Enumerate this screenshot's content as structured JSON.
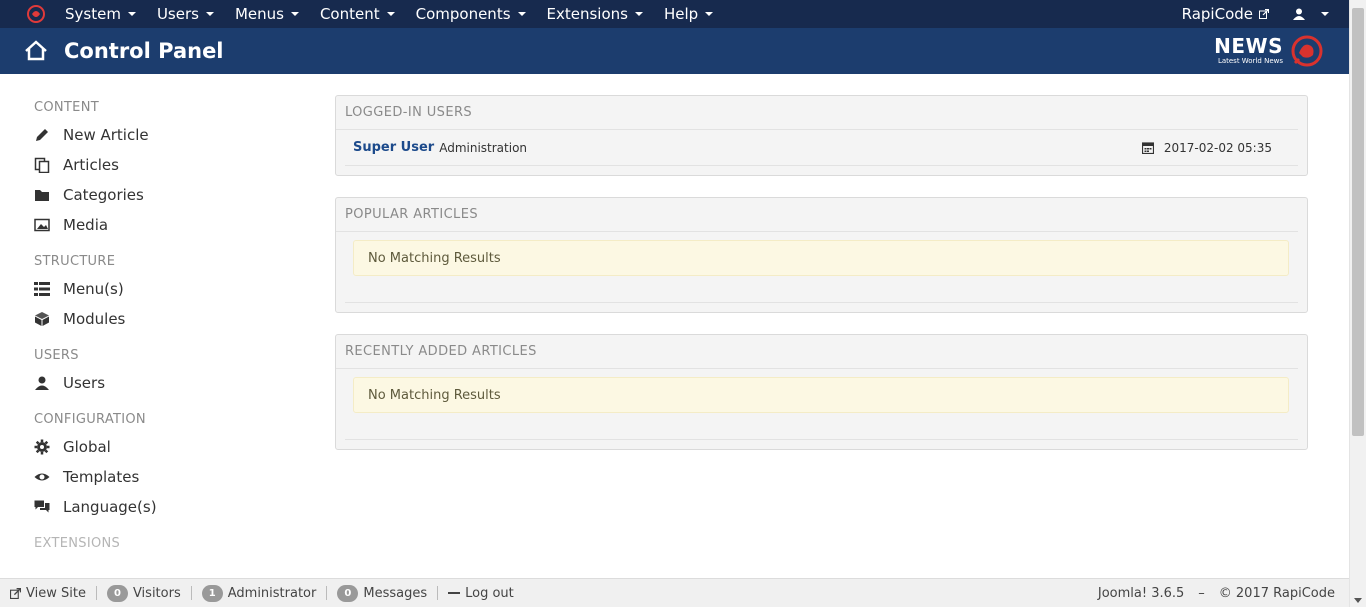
{
  "navbar": {
    "menus": [
      "System",
      "Users",
      "Menus",
      "Content",
      "Components",
      "Extensions",
      "Help"
    ],
    "site_link": "RapiCode",
    "user_menu_icon": "user-icon"
  },
  "header": {
    "title": "Control Panel",
    "brand": {
      "name": "NEWS",
      "tagline": "Latest World News"
    }
  },
  "sidebar": {
    "sections": [
      {
        "title": "CONTENT",
        "items": [
          {
            "label": "New Article",
            "icon": "pencil-icon"
          },
          {
            "label": "Articles",
            "icon": "copy-icon"
          },
          {
            "label": "Categories",
            "icon": "folder-icon"
          },
          {
            "label": "Media",
            "icon": "image-icon"
          }
        ]
      },
      {
        "title": "STRUCTURE",
        "items": [
          {
            "label": "Menu(s)",
            "icon": "list-icon"
          },
          {
            "label": "Modules",
            "icon": "cube-icon"
          }
        ]
      },
      {
        "title": "USERS",
        "items": [
          {
            "label": "Users",
            "icon": "user-icon"
          }
        ]
      },
      {
        "title": "CONFIGURATION",
        "items": [
          {
            "label": "Global",
            "icon": "gear-icon"
          },
          {
            "label": "Templates",
            "icon": "eye-icon"
          },
          {
            "label": "Language(s)",
            "icon": "comments-icon"
          }
        ]
      },
      {
        "title": "EXTENSIONS",
        "items": []
      }
    ]
  },
  "panels": {
    "logged_in": {
      "title": "LOGGED-IN USERS",
      "user": "Super User",
      "role": "Administration",
      "time": "2017-02-02 05:35"
    },
    "popular": {
      "title": "POPULAR ARTICLES",
      "message": "No Matching Results"
    },
    "recent": {
      "title": "RECENTLY ADDED ARTICLES",
      "message": "No Matching Results"
    }
  },
  "statusbar": {
    "view_site": "View Site",
    "visitors_count": "0",
    "visitors_label": "Visitors",
    "admin_count": "1",
    "admin_label": "Administrator",
    "messages_count": "0",
    "messages_label": "Messages",
    "logout": "Log out",
    "version": "Joomla! 3.6.5",
    "dash": "–",
    "copyright": "© 2017 RapiCode"
  },
  "colors": {
    "navbar_bg": "#172a4e",
    "header_bg": "#1c3d6e",
    "alert_bg": "#fcf8e3",
    "user_link": "#1c4a8b"
  }
}
